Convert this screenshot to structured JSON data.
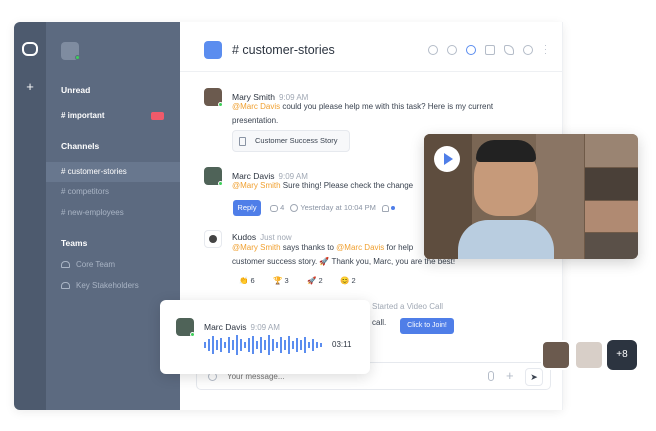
{
  "workspace": {
    "logo_icon": "chat-logo-icon",
    "add_icon": "plus-icon"
  },
  "sidebar": {
    "unread_label": "Unread",
    "important_channel": "# important",
    "channels_label": "Channels",
    "channels": [
      {
        "label": "# customer-stories",
        "active": true
      },
      {
        "label": "# competitors",
        "active": false
      },
      {
        "label": "# new-employees",
        "active": false
      }
    ],
    "teams_label": "Teams",
    "teams": [
      {
        "label": "Core Team"
      },
      {
        "label": "Key Stakeholders"
      }
    ]
  },
  "header": {
    "channel_name": "# customer-stories",
    "accent": "#5b8def"
  },
  "messages": [
    {
      "name": "Mary Smith",
      "time": "9:09 AM",
      "mention": "@Marc Davis",
      "text": " could you please help me with this task? Here is my current",
      "text2": "presentation.",
      "attachment": "Customer Success Story"
    },
    {
      "name": "Marc Davis",
      "time": "9:09 AM",
      "mention": "@Mary Smith",
      "text": " Sure thing! Please check the change",
      "reply_label": "Reply",
      "reply_count": "4",
      "meta": "Yesterday at 10:04 PM"
    },
    {
      "name": "Kudos",
      "time": "Just now",
      "mention": "@Mary Smith",
      "text": " says thanks to ",
      "mention2": "@Marc Davis",
      "text_b": " for help",
      "text2": "customer success story. 🚀 Thank you, Marc, you are the best!",
      "reactions": [
        {
          "emoji": "👏",
          "count": "6"
        },
        {
          "emoji": "🏆",
          "count": "3"
        },
        {
          "emoji": "🚀",
          "count": "2"
        },
        {
          "emoji": "😊",
          "count": "2"
        }
      ]
    }
  ],
  "call_notice": {
    "text": "Started a Video Call",
    "text2": "call.",
    "button": "Click to Join!"
  },
  "voice": {
    "name": "Marc Davis",
    "time": "9:09 AM",
    "duration": "03:11"
  },
  "composer": {
    "placeholder": "Your message..."
  },
  "participants": {
    "more": "+8"
  }
}
